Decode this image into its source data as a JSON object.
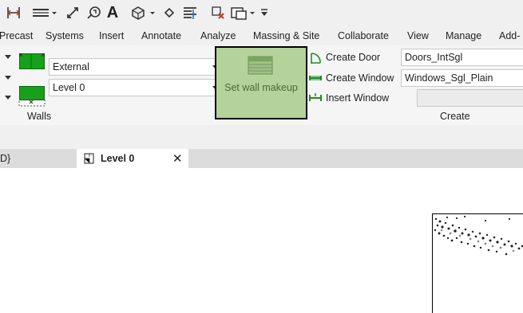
{
  "ribbon_tabs": [
    "Precast",
    "Systems",
    "Insert",
    "Annotate",
    "Analyze",
    "Massing & Site",
    "Collaborate",
    "View",
    "Manage",
    "Add-"
  ],
  "walls": {
    "type_value": "External",
    "level_value": "Level 0",
    "panel_label": "Walls"
  },
  "set_wall": {
    "label": "Set wall makeup"
  },
  "create": {
    "door_label": "Create Door",
    "window_label": "Create Window",
    "insert_label": "Insert Window",
    "door_value": "Doors_IntSgl",
    "window_value": "Windows_Sgl_Plain",
    "empty_value": "",
    "panel_label": "Create"
  },
  "doc_tabs": {
    "prev_label": "D}",
    "active_label": "Level 0",
    "close_glyph": "✕"
  },
  "colors": {
    "wall_green": "#17a11b",
    "highlight_fill": "#b3d39a",
    "highlight_border": "#000000"
  }
}
